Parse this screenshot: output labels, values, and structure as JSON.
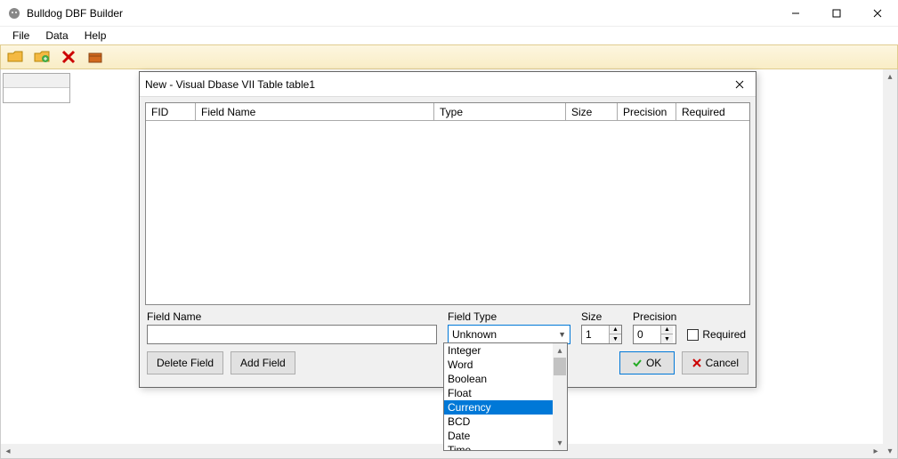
{
  "titlebar": {
    "title": "Bulldog DBF Builder"
  },
  "menu": {
    "items": [
      "File",
      "Data",
      "Help"
    ]
  },
  "toolbar": {
    "icons": [
      "folder-open-icon",
      "folder-add-icon",
      "delete-icon",
      "box-icon"
    ]
  },
  "dialog": {
    "title": "New - Visual Dbase VII Table table1",
    "columns": {
      "fid": "FID",
      "field_name": "Field Name",
      "type": "Type",
      "size": "Size",
      "precision": "Precision",
      "required": "Required"
    },
    "form": {
      "field_name_label": "Field Name",
      "field_name_value": "",
      "field_type_label": "Field Type",
      "field_type_value": "Unknown",
      "size_label": "Size",
      "size_value": "1",
      "precision_label": "Precision",
      "precision_value": "0",
      "required_label": "Required",
      "required_checked": false
    },
    "buttons": {
      "delete_field": "Delete Field",
      "add_field": "Add Field",
      "ok": "OK",
      "cancel": "Cancel"
    },
    "dropdown": {
      "options": [
        "Integer",
        "Word",
        "Boolean",
        "Float",
        "Currency",
        "BCD",
        "Date",
        "Time"
      ],
      "highlighted": "Currency"
    }
  }
}
